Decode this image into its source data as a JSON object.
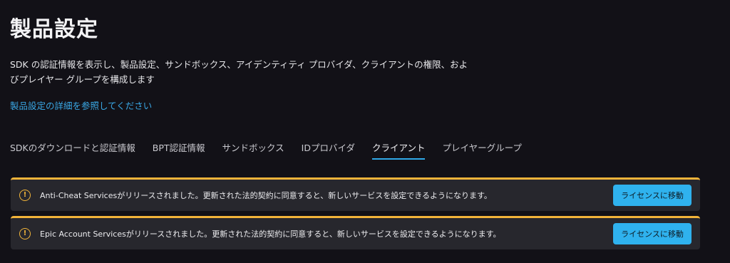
{
  "page": {
    "title": "製品設定",
    "description": "SDK の認証情報を表示し、製品設定、サンドボックス、アイデンティティ プロバイダ、クライアントの権限、およびプレイヤー グループを構成します",
    "doc_link": "製品設定の詳細を参照してください"
  },
  "tabs": [
    {
      "label": "SDKのダウンロードと認証情報",
      "active": false
    },
    {
      "label": "BPT認証情報",
      "active": false
    },
    {
      "label": "サンドボックス",
      "active": false
    },
    {
      "label": "IDプロバイダ",
      "active": false
    },
    {
      "label": "クライアント",
      "active": true
    },
    {
      "label": "プレイヤーグループ",
      "active": false
    }
  ],
  "notices": [
    {
      "icon": "warning-circle-icon",
      "text": "Anti-Cheat Servicesがリリースされました。更新された法的契約に同意すると、新しいサービスを設定できるようになります。",
      "button": "ライセンスに移動"
    },
    {
      "icon": "warning-circle-icon",
      "text": "Epic Account Servicesがリリースされました。更新された法的契約に同意すると、新しいサービスを設定できるようになります。",
      "button": "ライセンスに移動"
    }
  ],
  "colors": {
    "background": "#121117",
    "accent": "#2fb2ee",
    "link": "#3aa8e6",
    "warning": "#f3b43a",
    "notice_bg": "#27272d"
  }
}
